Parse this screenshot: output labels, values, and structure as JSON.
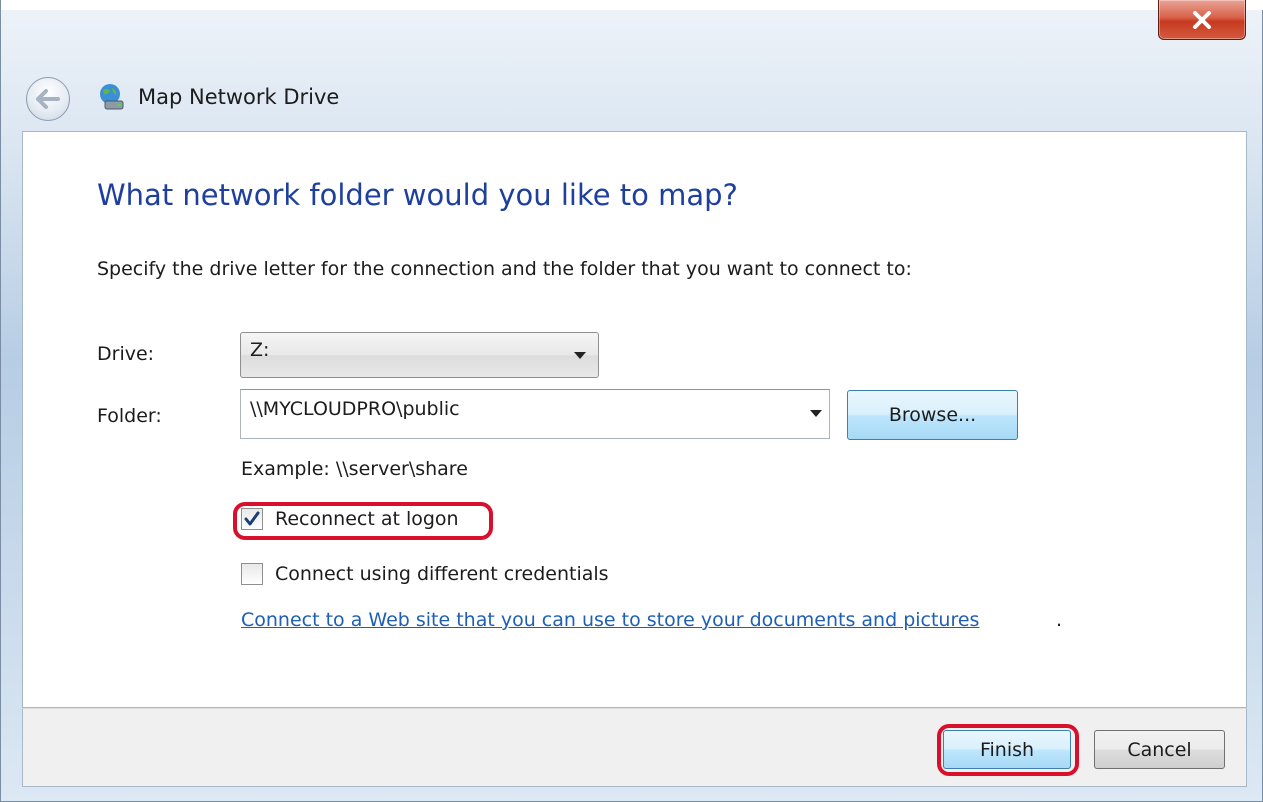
{
  "window": {
    "title": "Map Network Drive",
    "close_icon": "close-icon",
    "back_icon": "back-arrow-icon",
    "title_icon": "network-drive-icon"
  },
  "main": {
    "heading": "What network folder would you like to map?",
    "instruction": "Specify the drive letter for the connection and the folder that you want to connect to:",
    "drive": {
      "label": "Drive:",
      "value": "Z:"
    },
    "folder": {
      "label": "Folder:",
      "value": "\\\\MYCLOUDPRO\\public",
      "browse_label": "Browse..."
    },
    "example": "Example: \\\\server\\share",
    "reconnect": {
      "label": "Reconnect at logon",
      "checked": true
    },
    "credentials": {
      "label": "Connect using different credentials",
      "checked": false
    },
    "link_text": "Connect to a Web site that you can use to store your documents and pictures",
    "link_suffix": "."
  },
  "footer": {
    "finish_label": "Finish",
    "cancel_label": "Cancel"
  },
  "colors": {
    "heading": "#1e3f9e",
    "link": "#1e5fb5",
    "highlight": "#d8102b",
    "close_button": "#c63a20"
  }
}
